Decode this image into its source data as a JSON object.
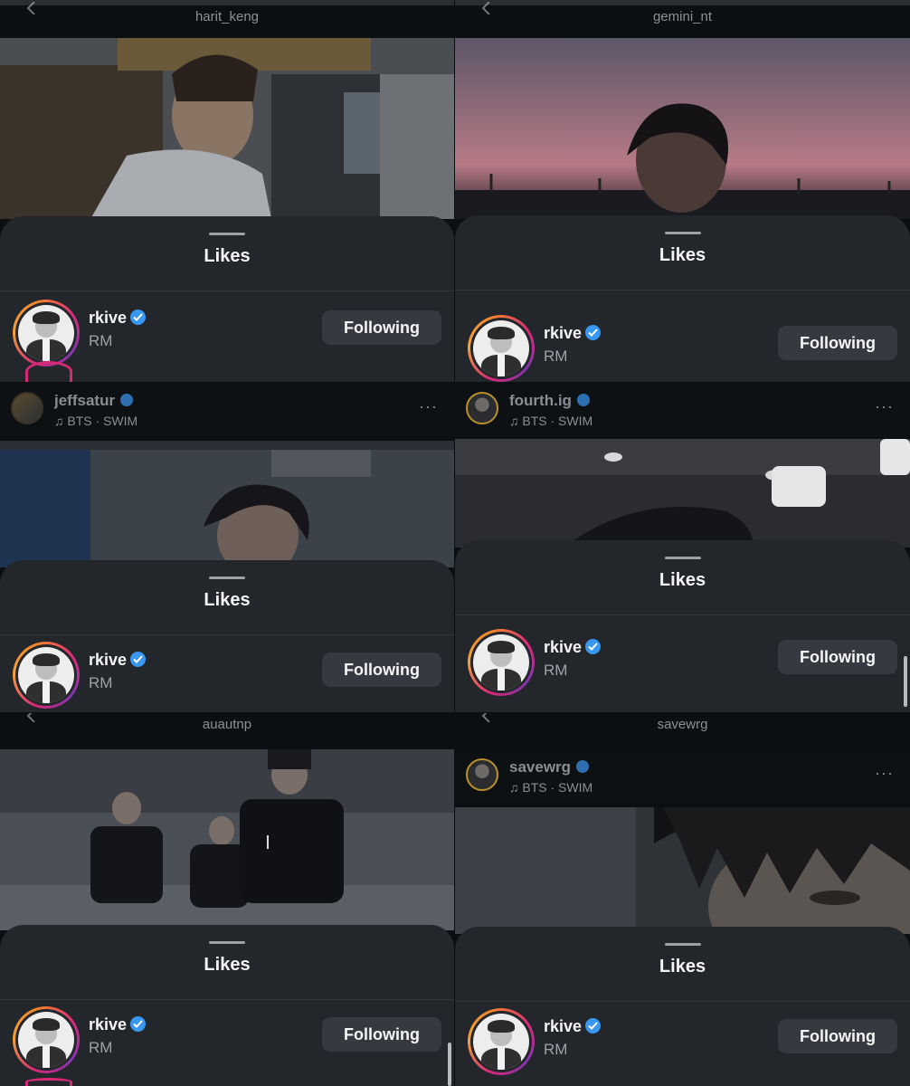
{
  "panels": [
    {
      "top_label": "harit_keng",
      "sheet_title": "Likes",
      "user": {
        "username": "rkive",
        "full_name": "RM",
        "button": "Following"
      }
    },
    {
      "top_label": "gemini_nt",
      "sheet_title": "Likes",
      "user": {
        "username": "rkive",
        "full_name": "RM",
        "button": "Following"
      }
    },
    {
      "post_user": "jeffsatur",
      "music": "BTS · SWIM",
      "sheet_title": "Likes",
      "user": {
        "username": "rkive",
        "full_name": "RM",
        "button": "Following"
      }
    },
    {
      "post_user": "fourth.ig",
      "music": "BTS · SWIM",
      "sheet_title": "Likes",
      "user": {
        "username": "rkive",
        "full_name": "RM",
        "button": "Following"
      }
    },
    {
      "top_label": "auautnp",
      "sheet_title": "Likes",
      "user": {
        "username": "rkive",
        "full_name": "RM",
        "button": "Following"
      }
    },
    {
      "top_label": "savewrg",
      "post_user": "savewrg",
      "music": "BTS · SWIM",
      "sheet_title": "Likes",
      "user": {
        "username": "rkive",
        "full_name": "RM",
        "button": "Following"
      }
    }
  ],
  "colors": {
    "sheet": "#23262b",
    "button": "#363a40",
    "verified": "#3897f0"
  },
  "icons": [
    "back-chevron-icon",
    "verified-badge-icon",
    "music-note-icon",
    "more-options-icon"
  ]
}
